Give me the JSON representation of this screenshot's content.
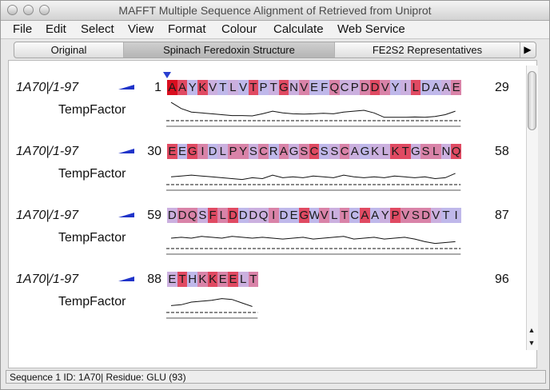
{
  "window": {
    "title": "MAFFT Multiple Sequence Alignment of Retrieved from Uniprot"
  },
  "menu": [
    "File",
    "Edit",
    "Select",
    "View",
    "Format",
    "Colour",
    "Calculate",
    "Web Service"
  ],
  "tabs": [
    {
      "label": "Original",
      "selected": false
    },
    {
      "label": "Spinach Feredoxin Structure",
      "selected": true
    },
    {
      "label": "FE2S2 Representatives",
      "selected": false
    }
  ],
  "rows": [
    {
      "name": "1A70|/1-97",
      "annotation": "TempFactor",
      "start": "1",
      "end": "29",
      "residues": "AAYKVTLVTPTGNVEFQCPDDVYILDAAE",
      "profile": [
        0.95,
        0.6,
        0.4,
        0.35,
        0.3,
        0.25,
        0.2,
        0.2,
        0.18,
        0.3,
        0.45,
        0.35,
        0.3,
        0.28,
        0.3,
        0.33,
        0.3,
        0.4,
        0.45,
        0.5,
        0.35,
        0.1,
        0.1,
        0.1,
        0.12,
        0.1,
        0.15,
        0.25,
        0.45
      ]
    },
    {
      "name": "1A70|/1-97",
      "annotation": "TempFactor",
      "start": "30",
      "end": "58",
      "residues": "EEGIDLPYSCRAGSCSSCAGKLKTGSLNQ",
      "profile": [
        0.35,
        0.4,
        0.45,
        0.4,
        0.35,
        0.3,
        0.25,
        0.2,
        0.3,
        0.25,
        0.45,
        0.3,
        0.35,
        0.3,
        0.4,
        0.35,
        0.3,
        0.45,
        0.35,
        0.3,
        0.35,
        0.3,
        0.4,
        0.35,
        0.3,
        0.35,
        0.25,
        0.3,
        0.55
      ]
    },
    {
      "name": "1A70|/1-97",
      "annotation": "TempFactor",
      "start": "59",
      "end": "87",
      "residues": "DDQSFLDDDQIDEGWVLTCAAYPVSDVTI",
      "profile": [
        0.5,
        0.55,
        0.5,
        0.6,
        0.55,
        0.5,
        0.6,
        0.55,
        0.5,
        0.55,
        0.5,
        0.45,
        0.5,
        0.55,
        0.45,
        0.5,
        0.55,
        0.6,
        0.45,
        0.5,
        0.55,
        0.45,
        0.5,
        0.55,
        0.45,
        0.3,
        0.2,
        0.25,
        0.3
      ]
    },
    {
      "name": "1A70|/1-97",
      "annotation": "TempFactor",
      "start": "88",
      "end": "96",
      "residues": "ETHKKEELT",
      "profile": [
        0.3,
        0.35,
        0.5,
        0.55,
        0.6,
        0.7,
        0.65,
        0.45,
        0.25
      ]
    }
  ],
  "colors": {
    "high": "#e04a62",
    "mid": "#d983a8",
    "low": "#cbb0df",
    "lowest": "#bfb8ea",
    "cursor_residue": "#d90f1f"
  },
  "status": "Sequence 1 ID: 1A70|  Residue: GLU (93)",
  "icons": {
    "flag": "blue-flag-icon",
    "scroll_up": "scroll-up-icon",
    "scroll_down": "scroll-down-icon",
    "tab_next": "tab-next-arrow-icon"
  }
}
